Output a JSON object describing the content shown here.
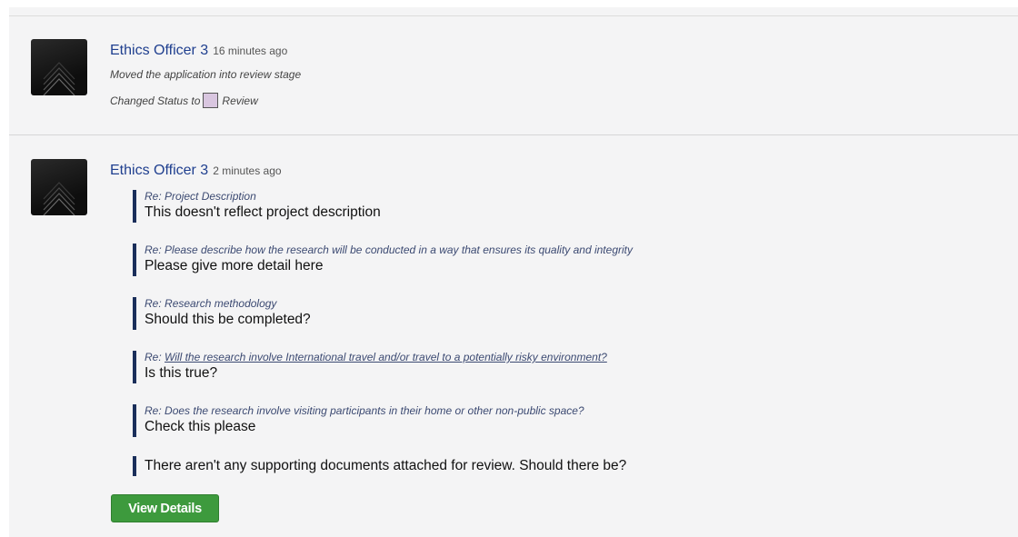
{
  "entries": [
    {
      "author": "Ethics Officer 3",
      "time": "16 minutes ago",
      "action": "Moved the application into review stage",
      "status_prefix": "Changed Status to",
      "status_value": "Review",
      "status_color": "#d9c6e0"
    },
    {
      "author": "Ethics Officer 3",
      "time": "2 minutes ago",
      "comments": [
        {
          "re_prefix": "Re:",
          "re": "Project Description",
          "text": "This doesn't reflect project description"
        },
        {
          "re_prefix": "Re:",
          "re": "Please describe how the research will be conducted in a way that ensures its quality and integrity",
          "text": "Please give more detail here"
        },
        {
          "re_prefix": "Re:",
          "re": "Research methodology",
          "text": "Should this be completed?"
        },
        {
          "re_prefix": "Re:",
          "re": "Will the research involve International travel and/or travel to a potentially risky environment?",
          "text": "Is this true?"
        },
        {
          "re_prefix": "Re:",
          "re": "Does the research involve visiting participants in their home or other non-public space?",
          "text": "Check this please"
        },
        {
          "text": "There aren't any supporting documents attached for review. Should there be?"
        }
      ],
      "button_label": "View Details"
    }
  ],
  "colors": {
    "author": "#1f3f8f",
    "comment_bar": "#1a2e5a",
    "button": "#3d9a3d"
  }
}
